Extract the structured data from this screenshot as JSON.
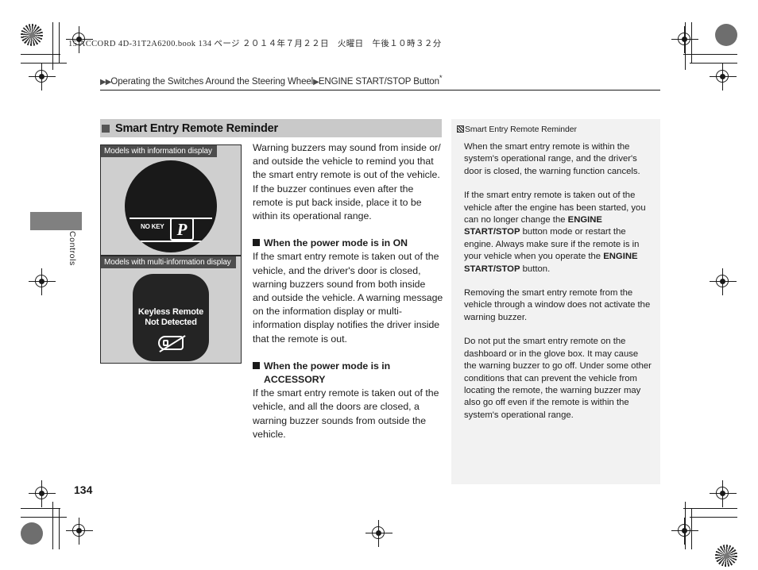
{
  "print": {
    "book_header": "15 ACCORD 4D-31T2A6200.book   134 ページ   ２０１４年７月２２日　火曜日　午後１０時３２分"
  },
  "breadcrumb": {
    "arrow_double": "▶▶",
    "level1": "Operating the Switches Around the Steering Wheel",
    "arrow_single": "▶",
    "level2": "ENGINE START/STOP Button",
    "asterisk": "*"
  },
  "side_tab": {
    "label": "Controls"
  },
  "section": {
    "title": "Smart Entry Remote Reminder"
  },
  "figures": [
    {
      "caption": "Models with information display",
      "screen_label_small": "NO KEY",
      "screen_symbol": "P"
    },
    {
      "caption": "Models with multi-information display",
      "screen_line1": "Keyless Remote",
      "screen_line2": "Not Detected"
    }
  ],
  "main": {
    "intro": "Warning buzzers may sound from inside or/ and outside the vehicle to remind you that the smart entry remote is out of the vehicle. If the buzzer continues even after the remote is put back inside, place it to be within its operational range.",
    "sub1_title": "When the power mode is in ON",
    "sub1_body": "If the smart entry remote is taken out of the vehicle, and the driver's door is closed, warning buzzers sound from both inside and outside the vehicle. A warning message on the information display or multi-information display notifies the driver inside that the remote is out.",
    "sub2_title_line1": "When the power mode is in",
    "sub2_title_line2": "ACCESSORY",
    "sub2_body": "If the smart entry remote is taken out of the vehicle, and all the doors are closed, a warning buzzer sounds from outside the vehicle."
  },
  "sidebar": {
    "heading": "Smart Entry Remote Reminder",
    "para1": "When the smart entry remote is within the system's operational range, and the driver's door is closed, the warning function cancels.",
    "para2_a": "If the smart entry remote is taken out of the vehicle after the engine has been started, you can no longer change the ",
    "para2_bold1": "ENGINE START/STOP",
    "para2_b": " button mode or restart the engine. Always make sure if the remote is in your vehicle when you operate the ",
    "para2_bold2": "ENGINE START/STOP",
    "para2_c": " button.",
    "para3": "Removing the smart entry remote from the vehicle through a window does not activate the warning buzzer.",
    "para4": "Do not put the smart entry remote on the dashboard or in the glove box. It may cause the warning buzzer to go off. Under some other conditions that can prevent the vehicle from locating the remote, the warning buzzer may also go off even if the remote is within the system's operational range."
  },
  "footer": {
    "page_number": "134"
  }
}
